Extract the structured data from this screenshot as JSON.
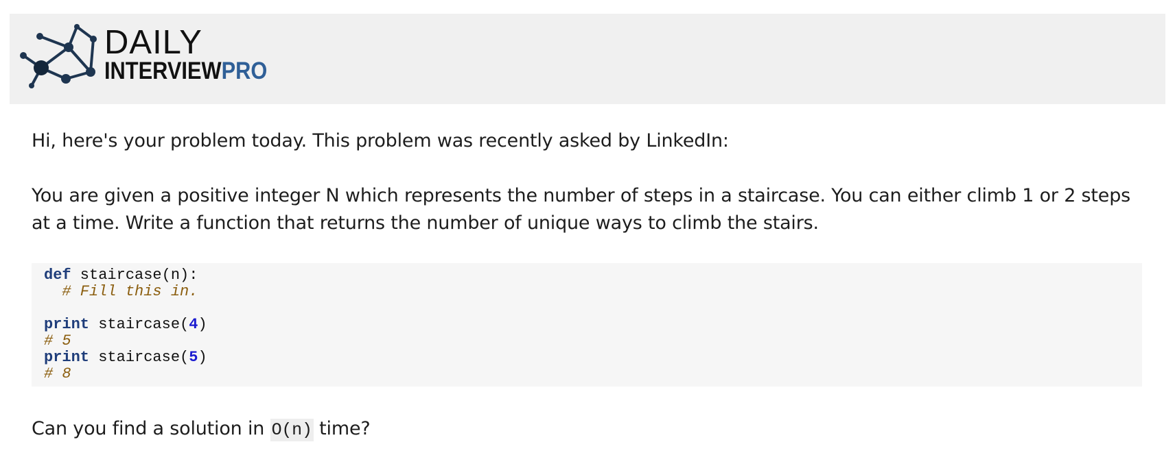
{
  "header": {
    "logo_word_daily": "DAILY",
    "logo_word_interview": "INTERVIEW",
    "logo_word_pro": "PRO",
    "brand_color": "#2f5f97",
    "logo_icon": "network-nodes-icon"
  },
  "email": {
    "intro": "Hi, here's your problem today. This problem was recently asked by LinkedIn:",
    "description": "You are given a positive integer N which represents the number of steps in a staircase. You can either climb 1 or 2 steps at a time. Write a function that returns the number of unique ways to climb the stairs.",
    "code": {
      "def_kw": "def",
      "def_sig": " staircase(n):",
      "fill_comment": "  # Fill this in.",
      "print_kw": "print",
      "call_prefix": " staircase(",
      "call1_arg": "4",
      "call_suffix": ")",
      "result1": "# 5",
      "call2_arg": "5",
      "result2": "# 8"
    },
    "question_prefix": "Can you find a solution in ",
    "question_code": "O(n)",
    "question_suffix": " time?"
  }
}
